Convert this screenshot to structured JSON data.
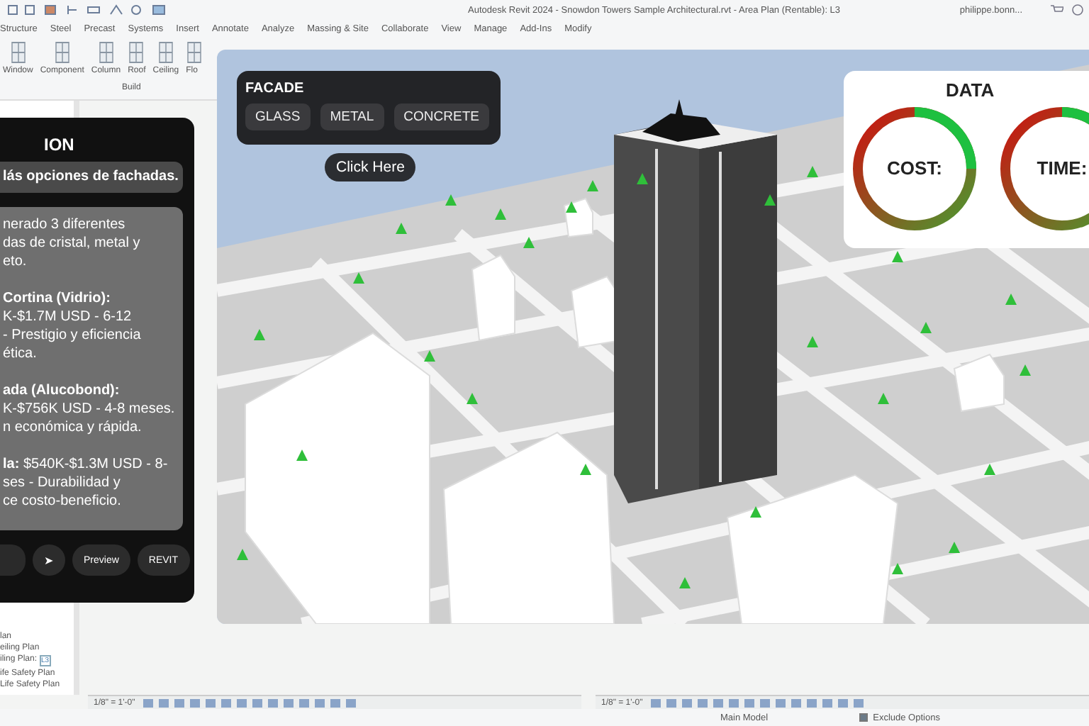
{
  "titlebar": {
    "title": "Autodesk Revit 2024 - Snowdon Towers Sample Architectural.rvt - Area Plan (Rentable): L3",
    "user": "philippe.bonn..."
  },
  "ribbon_tabs": [
    "Structure",
    "Steel",
    "Precast",
    "Systems",
    "Insert",
    "Annotate",
    "Analyze",
    "Massing & Site",
    "Collaborate",
    "View",
    "Manage",
    "Add-Ins",
    "Modify"
  ],
  "ribbon_tools": [
    "Window",
    "Component",
    "Column",
    "Roof",
    "Ceiling",
    "Flo"
  ],
  "ribbon_panel": "Build",
  "project_browser": {
    "items": [
      {
        "label": "lan"
      },
      {
        "label": "eiling Plan"
      },
      {
        "label": "iling Plan:",
        "badge": "L3"
      },
      {
        "label": "ife Safety Plan"
      },
      {
        "label": "Life Safety Plan"
      }
    ]
  },
  "view_bars": [
    {
      "scale": "1/8\" = 1'-0\""
    },
    {
      "scale": "1/8\" = 1'-0\""
    }
  ],
  "status_bar": {
    "model": "Main Model",
    "exclude_options": {
      "label": "Exclude Options",
      "checked": true
    }
  },
  "facade_panel": {
    "title": "FACADE",
    "options": [
      {
        "label": "GLASS",
        "selected": false
      },
      {
        "label": "METAL",
        "selected": false
      },
      {
        "label": "CONCRETE",
        "selected": false
      }
    ]
  },
  "click_button": "Click Here",
  "chat": {
    "title": "ION",
    "user_message": "lás opciones de fachadas.",
    "reply": [
      [
        "nerado 3 diferentes",
        "das de cristal, metal y",
        "eto."
      ],
      [
        "**Cortina (Vidrio):**",
        "K-$1.7M USD - 6-12",
        "- Prestigio y eficiencia",
        "ética."
      ],
      [
        "**ada (Alucobond):**",
        "K-$756K USD - 4-8 meses.",
        "n económica y rápida."
      ],
      [
        "**la:** $540K-$1.3M USD - 8-",
        "ses - Durabilidad y",
        "ce costo-beneficio."
      ]
    ],
    "send": "➤",
    "preview": "Preview",
    "revit": "REVIT"
  },
  "data_card": {
    "title": "DATA",
    "gauges": [
      {
        "label": "COST:"
      },
      {
        "label": "TIME:"
      }
    ]
  }
}
